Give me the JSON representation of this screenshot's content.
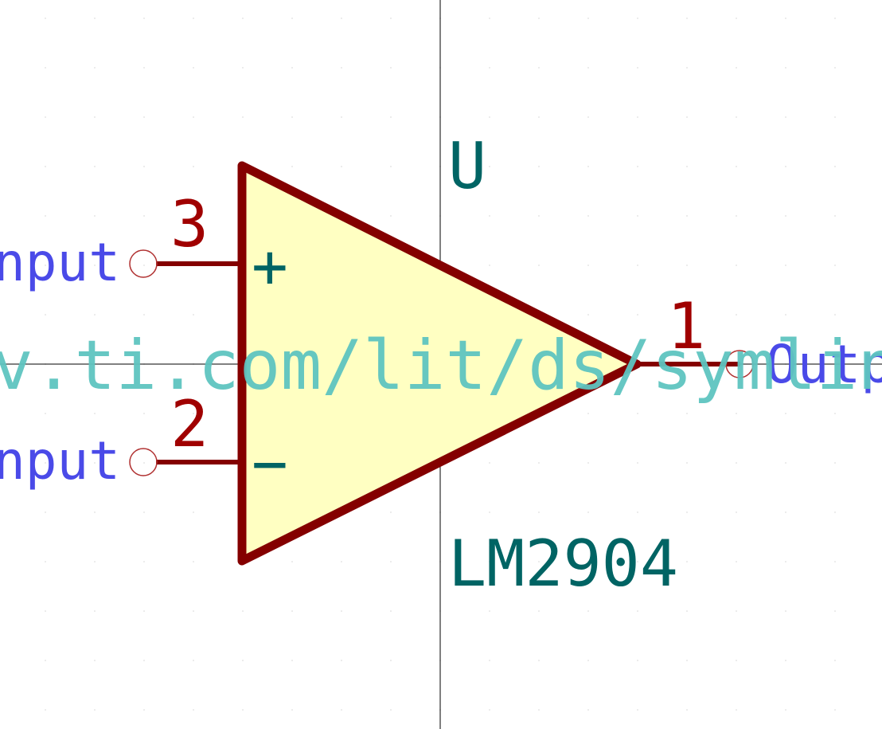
{
  "symbol": {
    "reference": "U",
    "value": "LM2904",
    "datasheet": "www.ti.com/lit/ds/symlink",
    "datasheet_visible": "v.ti.com/lit/ds/symlink"
  },
  "pins": [
    {
      "number": "3",
      "name": "Input",
      "name_visible": "nput",
      "marker": "+"
    },
    {
      "number": "2",
      "name": "Input",
      "name_visible": "nput",
      "marker": "−"
    },
    {
      "number": "1",
      "name": "Output",
      "name_visible": "Outp",
      "marker": ""
    }
  ],
  "colors": {
    "body_fill": "#ffffc2",
    "body_stroke": "#840000",
    "pin": "#840000",
    "pin_number": "#a00000",
    "pin_name": "#4a4ae8",
    "field_text": "#006464",
    "datasheet_text": "#5ec4c0",
    "crosshair": "#000000",
    "grid_dot": "#e6e6e6"
  }
}
